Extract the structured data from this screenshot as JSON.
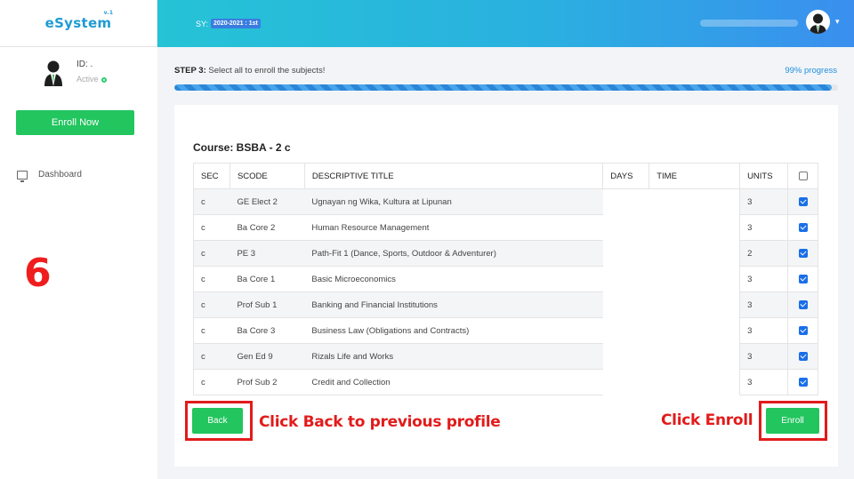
{
  "app": {
    "logo": "eSystem",
    "logo_version": "v.1"
  },
  "header": {
    "sy_label": "SY:",
    "sy_value": "2020-2021 : 1st"
  },
  "sidebar": {
    "user_id": "ID: .",
    "status": "Active",
    "enroll_now": "Enroll Now",
    "nav": [
      {
        "label": "Dashboard",
        "icon": "monitor-icon"
      }
    ]
  },
  "overlay": {
    "step_number": "6",
    "back_annotation": "Click Back to previous profile",
    "enroll_annotation": "Click Enroll",
    "annotation_color": "#e21b1b"
  },
  "main": {
    "step_bold": "STEP 3:",
    "step_text": " Select all to enroll the subjects!",
    "progress_label": "99% progress",
    "progress_value": 99,
    "course_title": "Course: BSBA - 2 c",
    "columns": [
      "SEC",
      "SCODE",
      "DESCRIPTIVE TITLE",
      "DAYS",
      "TIME",
      "UNITS"
    ],
    "rows": [
      {
        "sec": "c",
        "scode": "GE Elect 2",
        "title": "Ugnayan ng Wika, Kultura at Lipunan",
        "units": "3",
        "checked": true
      },
      {
        "sec": "c",
        "scode": "Ba Core 2",
        "title": "Human Resource Management",
        "units": "3",
        "checked": true
      },
      {
        "sec": "c",
        "scode": "PE 3",
        "title": "Path-Fit 1 (Dance, Sports, Outdoor & Adventurer)",
        "units": "2",
        "checked": true
      },
      {
        "sec": "c",
        "scode": "Ba Core 1",
        "title": "Basic Microeconomics",
        "units": "3",
        "checked": true
      },
      {
        "sec": "c",
        "scode": "Prof Sub 1",
        "title": "Banking and Financial Institutions",
        "units": "3",
        "checked": true
      },
      {
        "sec": "c",
        "scode": "Ba Core 3",
        "title": "Business Law (Obligations and Contracts)",
        "units": "3",
        "checked": true
      },
      {
        "sec": "c",
        "scode": "Gen Ed 9",
        "title": "Rizals Life and Works",
        "units": "3",
        "checked": true
      },
      {
        "sec": "c",
        "scode": "Prof Sub 2",
        "title": "Credit and Collection",
        "units": "3",
        "checked": true
      }
    ],
    "back_label": "Back",
    "enroll_label": "Enroll"
  },
  "colors": {
    "accent_green": "#22c55e",
    "header_start": "#25c3d6",
    "header_end": "#3a8fee",
    "checkbox_blue": "#1a6fe8"
  }
}
